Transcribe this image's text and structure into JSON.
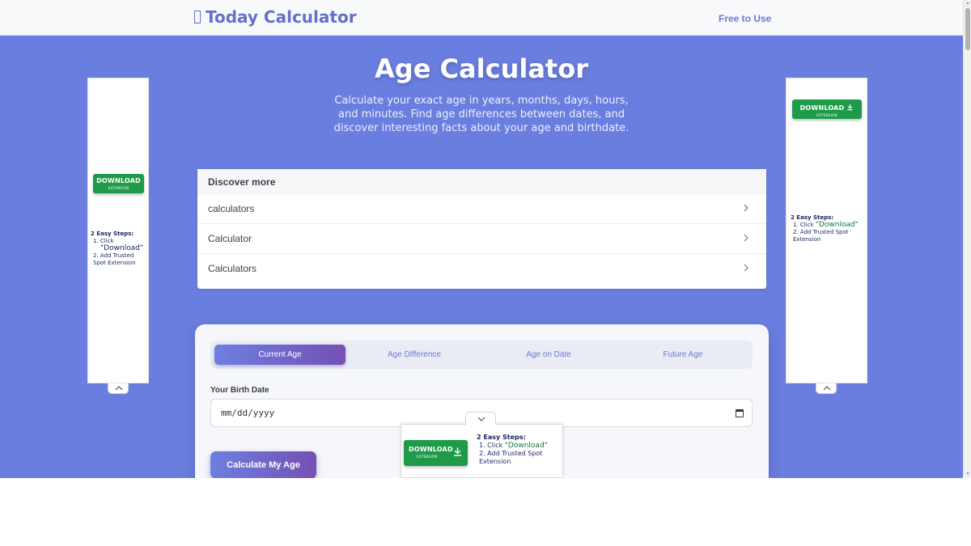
{
  "header": {
    "logo_text": "Today Calculator",
    "logo_glyph": "tofu-box",
    "free_link": "Free to Use"
  },
  "hero": {
    "title": "Age Calculator",
    "subtitle": "Calculate your exact age in years, months, days, hours, and minutes. Find age differences between dates, and discover interesting facts about your age and birthdate."
  },
  "discover": {
    "heading": "Discover more",
    "items": [
      {
        "label": "calculators"
      },
      {
        "label": "Calculator"
      },
      {
        "label": "Calculators"
      }
    ]
  },
  "calculator": {
    "tabs": [
      {
        "label": "Current Age",
        "active": true
      },
      {
        "label": "Age Difference",
        "active": false
      },
      {
        "label": "Age on Date",
        "active": false
      },
      {
        "label": "Future Age",
        "active": false
      }
    ],
    "birth_date_label": "Your Birth Date",
    "birth_date_placeholder": "mm/dd/yyyy",
    "calculate_button": "Calculate My Age"
  },
  "ads": {
    "download_label": "DOWNLOAD",
    "extension_label": "EXTENSION",
    "steps_heading": "2 Easy Steps:",
    "step1_prefix": "1. Click ",
    "step1_quote": "\"Download\"",
    "step2": "2. Add Trusted Spot Extension"
  },
  "colors": {
    "hero_bg": "#6a7ee0",
    "accent_start": "#6d7fe0",
    "accent_end": "#7550b4",
    "ad_green": "#1e9b49",
    "header_link": "#6b78d6"
  },
  "icons": [
    "chevron-right-icon",
    "calendar-icon",
    "download-icon",
    "chevron-up-icon",
    "chevron-down-icon"
  ]
}
